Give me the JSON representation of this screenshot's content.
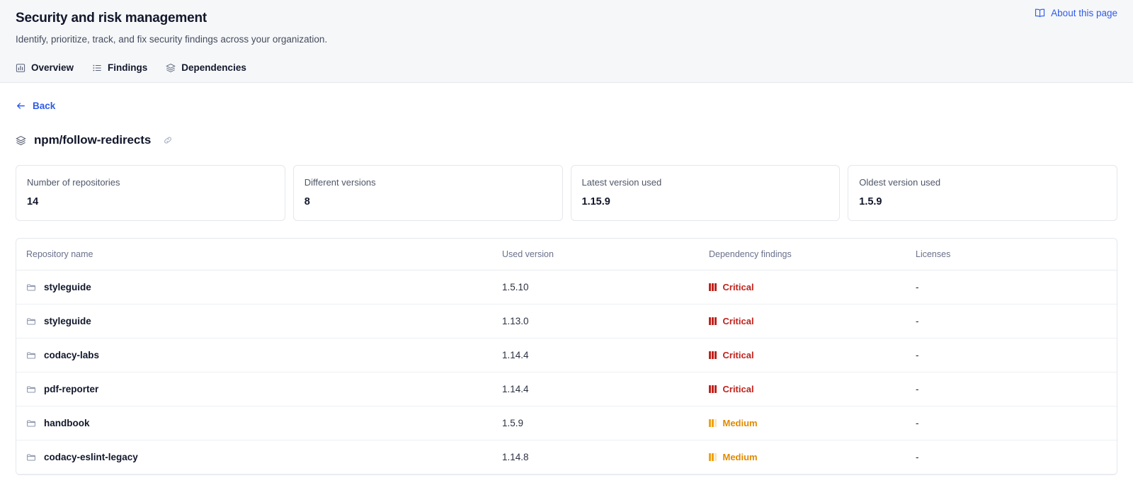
{
  "header": {
    "title": "Security and risk management",
    "subtitle": "Identify, prioritize, track, and fix security findings across your organization.",
    "about_link": "About this page",
    "about_icon": "book-open-icon"
  },
  "tabs": [
    {
      "label": "Overview",
      "icon": "bar-chart-icon",
      "active": false
    },
    {
      "label": "Findings",
      "icon": "list-icon",
      "active": false
    },
    {
      "label": "Dependencies",
      "icon": "layers-icon",
      "active": true
    }
  ],
  "back": {
    "label": "Back",
    "icon": "arrow-left-icon"
  },
  "package": {
    "icon": "layers-icon",
    "name": "npm/follow-redirects",
    "link_icon": "link-icon"
  },
  "stat_cards": [
    {
      "label": "Number of repositories",
      "value": "14"
    },
    {
      "label": "Different versions",
      "value": "8"
    },
    {
      "label": "Latest version used",
      "value": "1.15.9"
    },
    {
      "label": "Oldest version used",
      "value": "1.5.9"
    }
  ],
  "table": {
    "columns": [
      "Repository name",
      "Used version",
      "Dependency findings",
      "Licenses"
    ],
    "rows": [
      {
        "repo": "styleguide",
        "version": "1.5.10",
        "severity": "Critical",
        "level": 3,
        "licenses": "-"
      },
      {
        "repo": "styleguide",
        "version": "1.13.0",
        "severity": "Critical",
        "level": 3,
        "licenses": "-"
      },
      {
        "repo": "codacy-labs",
        "version": "1.14.4",
        "severity": "Critical",
        "level": 3,
        "licenses": "-"
      },
      {
        "repo": "pdf-reporter",
        "version": "1.14.4",
        "severity": "Critical",
        "level": 3,
        "licenses": "-"
      },
      {
        "repo": "handbook",
        "version": "1.5.9",
        "severity": "Medium",
        "level": 2,
        "licenses": "-"
      },
      {
        "repo": "codacy-eslint-legacy",
        "version": "1.14.8",
        "severity": "Medium",
        "level": 2,
        "licenses": "-"
      }
    ]
  },
  "colors": {
    "accent": "#2f5bea",
    "critical": "#c0231d",
    "medium": "#f0a211",
    "header_bg": "#f6f7f9",
    "border": "#e4e7ec"
  }
}
